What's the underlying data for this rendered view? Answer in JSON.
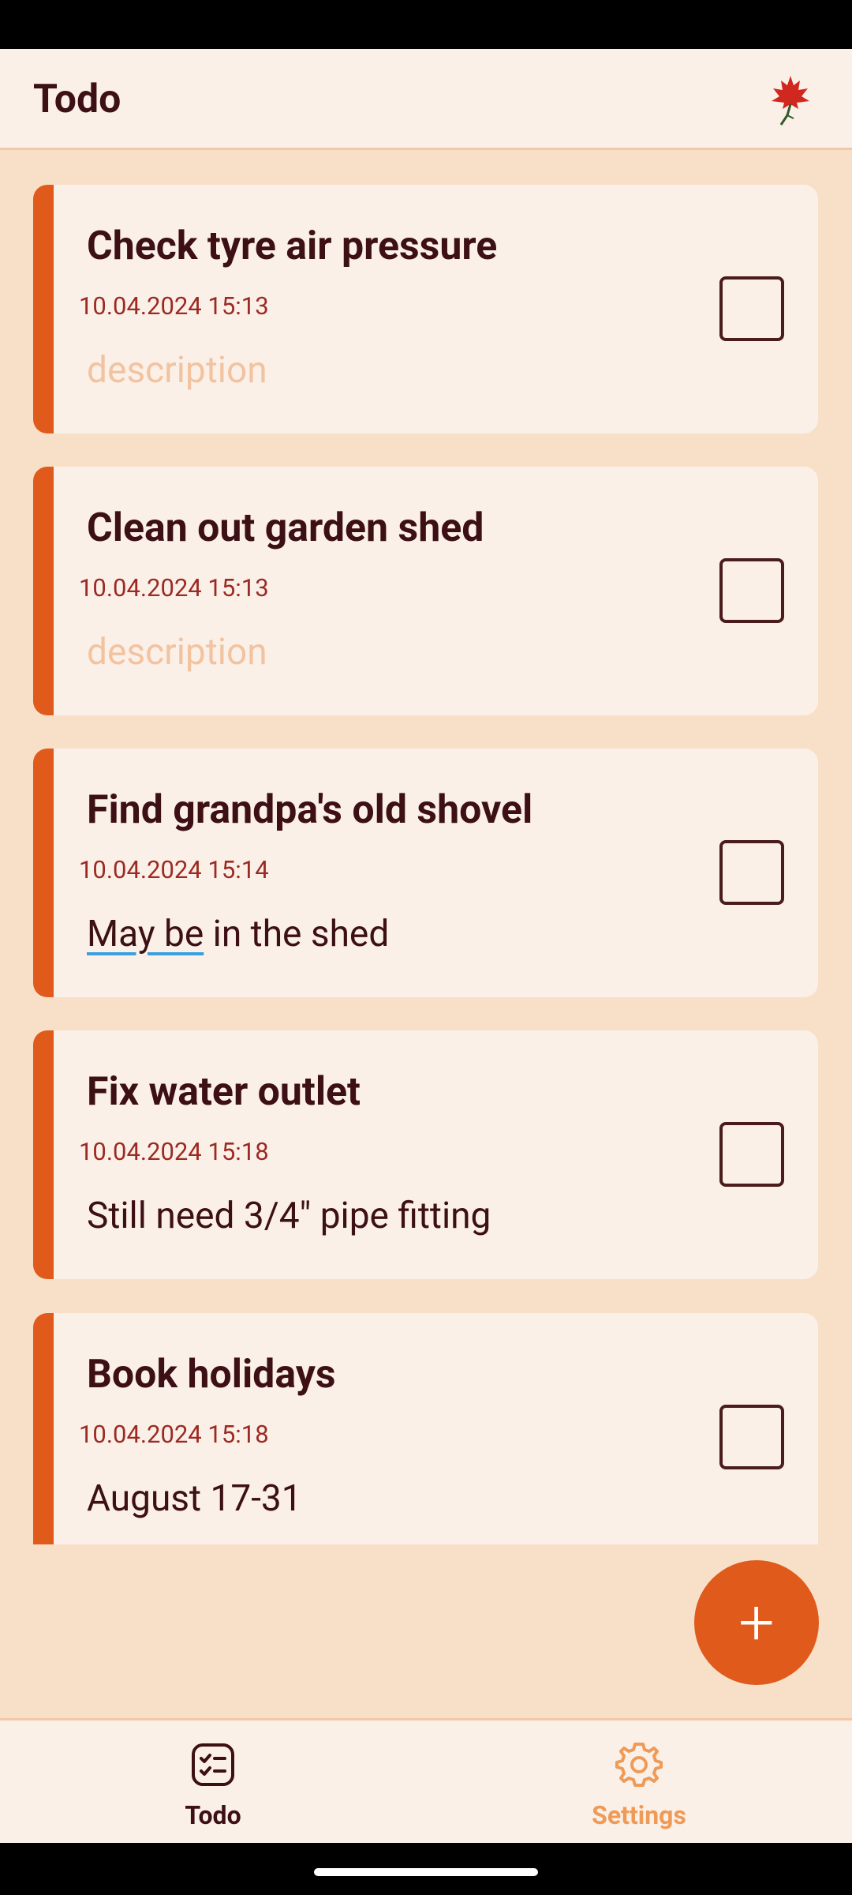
{
  "app": {
    "title": "Todo"
  },
  "todos": [
    {
      "title": "Check tyre air pressure",
      "date": "10.04.2024 15:13",
      "description": "description",
      "description_is_placeholder": true,
      "checked": false
    },
    {
      "title": "Clean out garden shed",
      "date": "10.04.2024 15:13",
      "description": "description",
      "description_is_placeholder": true,
      "checked": false
    },
    {
      "title": "Find grandpa's old shovel",
      "date": "10.04.2024 15:14",
      "description_part1": "May be",
      "description_part2": " in the shed",
      "checked": false
    },
    {
      "title": "Fix water outlet",
      "date": "10.04.2024 15:18",
      "description": "Still need 3/4\" pipe fitting",
      "checked": false
    },
    {
      "title": "Book holidays",
      "date": "10.04.2024 15:18",
      "description": "August 17-31",
      "checked": false
    }
  ],
  "fab": {
    "icon": "plus-icon"
  },
  "bottom_nav": {
    "items": [
      {
        "label": "Todo",
        "icon": "checklist-icon",
        "active": true
      },
      {
        "label": "Settings",
        "icon": "gear-icon",
        "active": false
      }
    ]
  },
  "colors": {
    "accent": "#df5a1b",
    "background": "#f8e0c8",
    "surface": "#fbf0e8",
    "text": "#3c1014",
    "date_text": "#9b2a22",
    "placeholder": "#f2c3a0",
    "inactive_nav": "#ef9a57"
  }
}
